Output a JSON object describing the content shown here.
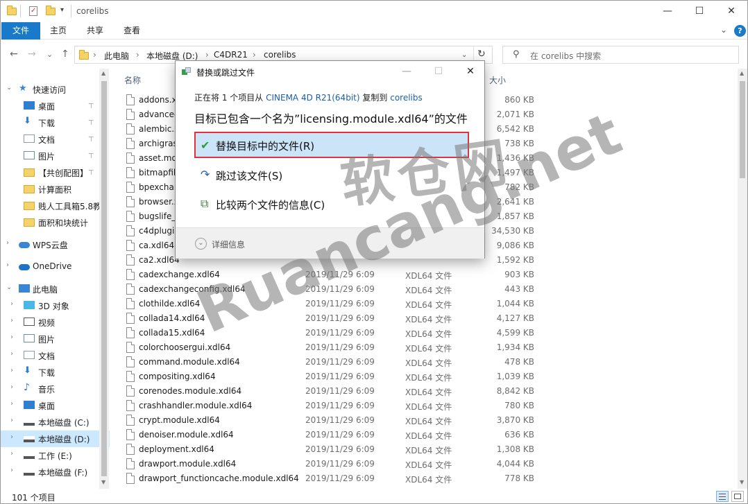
{
  "window": {
    "title": "corelibs",
    "controls": {
      "minimize": "—",
      "maximize": "☐",
      "close": "✕"
    }
  },
  "ribbon": {
    "tabs": [
      {
        "label": "文件",
        "active": true
      },
      {
        "label": "主页"
      },
      {
        "label": "共享"
      },
      {
        "label": "查看"
      }
    ],
    "collapse_glyph": "⌄",
    "help_glyph": "?"
  },
  "nav": {
    "back": "←",
    "forward": "→",
    "recent": "⌄",
    "up": "↑",
    "breadcrumb": [
      "此电脑",
      "本地磁盘 (D:)",
      "C4DR21",
      "corelibs"
    ],
    "separator": "›",
    "refresh": "↻",
    "search_placeholder": "在 corelibs 中搜索"
  },
  "sidebar": {
    "items": [
      {
        "label": "快速访问",
        "icon": "star-icon",
        "level": 0,
        "expand": "⌄"
      },
      {
        "label": "桌面",
        "icon": "desktop-icon",
        "level": 1,
        "pinned": true
      },
      {
        "label": "下载",
        "icon": "download-icon",
        "level": 1,
        "pinned": true
      },
      {
        "label": "文档",
        "icon": "document-icon",
        "level": 1,
        "pinned": true
      },
      {
        "label": "图片",
        "icon": "picture-icon",
        "level": 1,
        "pinned": true
      },
      {
        "label": "【共创配图】",
        "icon": "folder-icon",
        "level": 1,
        "pinned": true
      },
      {
        "label": "计算面积",
        "icon": "folder-icon",
        "level": 1
      },
      {
        "label": "贱人工具箱5.8教",
        "icon": "folder-icon",
        "level": 1
      },
      {
        "label": "面积和块统计",
        "icon": "folder-icon",
        "level": 1
      },
      {
        "label": "WPS云盘",
        "icon": "cloud-icon",
        "level": 0,
        "expand": "›"
      },
      {
        "label": "OneDrive",
        "icon": "onedrive-icon",
        "level": 0,
        "expand": "›"
      },
      {
        "label": "此电脑",
        "icon": "computer-icon",
        "level": 0,
        "expand": "⌄"
      },
      {
        "label": "3D 对象",
        "icon": "3d-objects-icon",
        "level": 1,
        "expand": "›"
      },
      {
        "label": "视频",
        "icon": "video-icon",
        "level": 1,
        "expand": "›"
      },
      {
        "label": "图片",
        "icon": "picture-icon",
        "level": 1,
        "expand": "›"
      },
      {
        "label": "文档",
        "icon": "document-icon",
        "level": 1,
        "expand": "›"
      },
      {
        "label": "下载",
        "icon": "download-icon",
        "level": 1,
        "expand": "›"
      },
      {
        "label": "音乐",
        "icon": "music-icon",
        "level": 1,
        "expand": "›"
      },
      {
        "label": "桌面",
        "icon": "desktop-icon",
        "level": 1,
        "expand": "›"
      },
      {
        "label": "本地磁盘 (C:)",
        "icon": "drive-icon",
        "level": 1,
        "expand": "›"
      },
      {
        "label": "本地磁盘 (D:)",
        "icon": "drive-icon",
        "level": 1,
        "expand": "›",
        "selected": true
      },
      {
        "label": "工作 (E:)",
        "icon": "drive-icon",
        "level": 1,
        "expand": "›"
      },
      {
        "label": "本地磁盘 (F:)",
        "icon": "drive-icon",
        "level": 1,
        "expand": "›"
      }
    ],
    "pin_glyph": "📌"
  },
  "columns": {
    "name": "名称",
    "size": "大小"
  },
  "files": [
    {
      "name": "addons.xdl64",
      "date": "",
      "type": "",
      "size": "860 KB"
    },
    {
      "name": "advanced",
      "date": "",
      "type": "",
      "size": "2,071 KB"
    },
    {
      "name": "alembic.x",
      "date": "",
      "type": "",
      "size": "6,542 KB"
    },
    {
      "name": "archigras",
      "date": "",
      "type": "",
      "size": "738 KB"
    },
    {
      "name": "asset.mod",
      "date": "",
      "type": "",
      "size": "1,436 KB"
    },
    {
      "name": "bitmapfilt",
      "date": "",
      "type": "",
      "size": "1,497 KB"
    },
    {
      "name": "bpexchan",
      "date": "",
      "type": "",
      "size": "782 KB"
    },
    {
      "name": "browser.x",
      "date": "",
      "type": "",
      "size": "2,641 KB"
    },
    {
      "name": "bugslife_c",
      "date": "",
      "type": "",
      "size": "1,857 KB"
    },
    {
      "name": "c4dplugin",
      "date": "",
      "type": "",
      "size": "34,530 KB"
    },
    {
      "name": "ca.xdl64",
      "date": "",
      "type": "",
      "size": "9,086 KB"
    },
    {
      "name": "ca2.xdl64",
      "date": "",
      "type": "",
      "size": "1,592 KB"
    },
    {
      "name": "cadexchange.xdl64",
      "date": "2019/11/29 6:09",
      "type": "XDL64 文件",
      "size": "903 KB"
    },
    {
      "name": "cadexchangeconfig.xdl64",
      "date": "2019/11/29 6:09",
      "type": "XDL64 文件",
      "size": "443 KB"
    },
    {
      "name": "clothilde.xdl64",
      "date": "2019/11/29 6:09",
      "type": "XDL64 文件",
      "size": "1,044 KB"
    },
    {
      "name": "collada14.xdl64",
      "date": "2019/11/29 6:09",
      "type": "XDL64 文件",
      "size": "4,127 KB"
    },
    {
      "name": "collada15.xdl64",
      "date": "2019/11/29 6:09",
      "type": "XDL64 文件",
      "size": "4,599 KB"
    },
    {
      "name": "colorchoosergui.xdl64",
      "date": "2019/11/29 6:09",
      "type": "XDL64 文件",
      "size": "1,934 KB"
    },
    {
      "name": "command.module.xdl64",
      "date": "2019/11/29 6:09",
      "type": "XDL64 文件",
      "size": "478 KB"
    },
    {
      "name": "compositing.xdl64",
      "date": "2019/11/29 6:09",
      "type": "XDL64 文件",
      "size": "1,039 KB"
    },
    {
      "name": "corenodes.module.xdl64",
      "date": "2019/11/29 6:09",
      "type": "XDL64 文件",
      "size": "8,842 KB"
    },
    {
      "name": "crashhandler.module.xdl64",
      "date": "2019/11/29 6:09",
      "type": "XDL64 文件",
      "size": "780 KB"
    },
    {
      "name": "crypt.module.xdl64",
      "date": "2019/11/29 6:09",
      "type": "XDL64 文件",
      "size": "3,870 KB"
    },
    {
      "name": "denoiser.module.xdl64",
      "date": "2019/11/29 6:09",
      "type": "XDL64 文件",
      "size": "636 KB"
    },
    {
      "name": "deployment.xdl64",
      "date": "2019/11/29 6:09",
      "type": "XDL64 文件",
      "size": "1,308 KB"
    },
    {
      "name": "drawport.module.xdl64",
      "date": "2019/11/29 6:09",
      "type": "XDL64 文件",
      "size": "4,044 KB"
    },
    {
      "name": "drawport_functioncache.module.xdl64",
      "date": "2019/11/29 6:09",
      "type": "XDL64 文件",
      "size": "778 KB"
    }
  ],
  "status": {
    "count": "101 个项目"
  },
  "dialog": {
    "title": "替换或跳过文件",
    "controls": {
      "minimize": "—",
      "maximize": "☐",
      "close": "✕"
    },
    "sub_prefix": "正在将 1 个项目从",
    "sub_source": "CINEMA 4D R21(64bit)",
    "sub_mid": "复制到",
    "sub_dest": "corelibs",
    "message": "目标已包含一个名为”licensing.module.xdl64”的文件",
    "options": [
      {
        "label": "替换目标中的文件(R)",
        "icon": "check-icon",
        "glyph": "✔",
        "highlight": true
      },
      {
        "label": "跳过该文件(S)",
        "icon": "skip-icon",
        "glyph": "↷"
      },
      {
        "label": "比较两个文件的信息(C)",
        "icon": "compare-icon",
        "glyph": "⧉"
      }
    ],
    "details_glyph": "⌄",
    "details_label": "详细信息"
  },
  "watermark": {
    "line1": "软仓网",
    "line2": "Ruancang.net"
  },
  "colors": {
    "accent": "#1979ca",
    "highlight_border": "#e0323b",
    "highlight_bg": "#cce4f7"
  }
}
